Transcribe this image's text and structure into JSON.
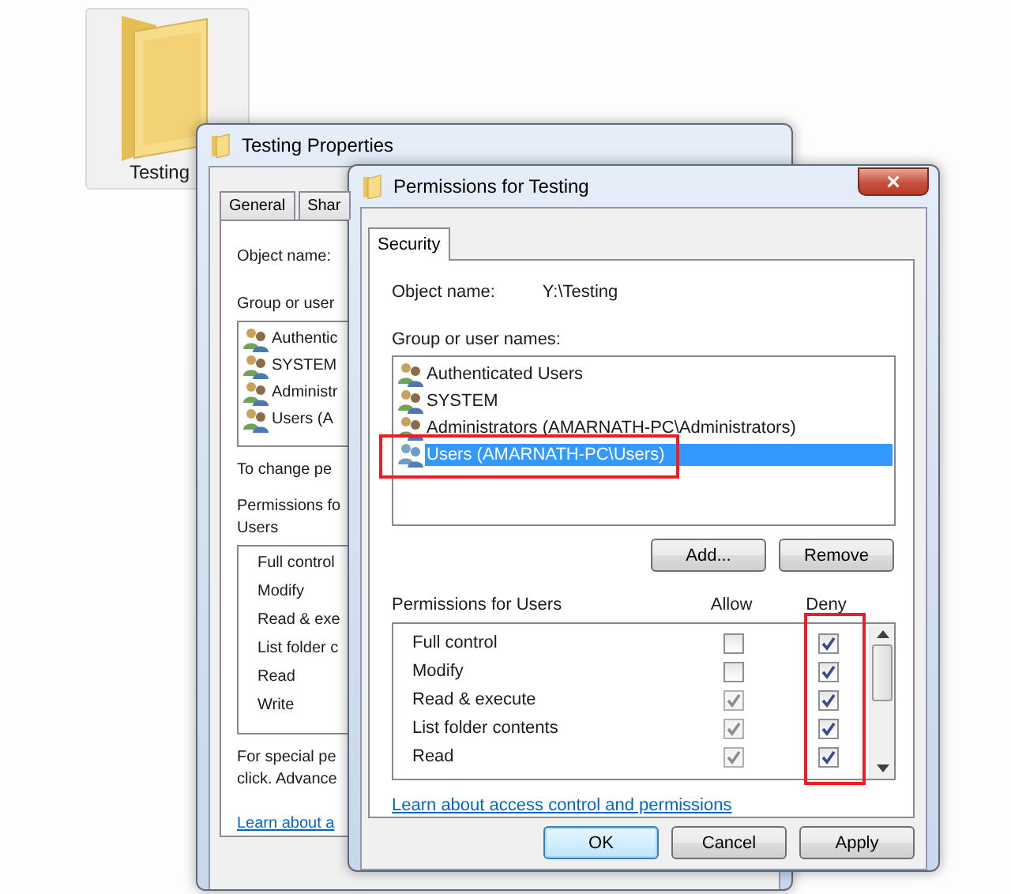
{
  "desktop_icon": {
    "label": "Testing",
    "selected": true
  },
  "properties_window": {
    "title": "Testing Properties",
    "tabs": [
      {
        "label": "General",
        "selected": false
      },
      {
        "label": "Shar",
        "selected": false
      }
    ],
    "object_name_label": "Object name:",
    "group_label": "Group or user",
    "users": [
      "Authentic",
      "SYSTEM",
      "Administr",
      "Users (A"
    ],
    "change_text": "To change pe",
    "permissions_label": "Permissions fo",
    "permissions_user": "Users",
    "permissions": [
      "Full control",
      "Modify",
      "Read & exe",
      "List folder c",
      "Read",
      "Write"
    ],
    "special_text": [
      "For special pe",
      "click. Advance"
    ],
    "link": "Learn about a"
  },
  "permissions_window": {
    "title": "Permissions for Testing",
    "close": "×",
    "tabs": [
      {
        "label": "Security",
        "selected": true
      }
    ],
    "object_name_label": "Object name:",
    "object_name": "Y:\\Testing",
    "group_label": "Group or user names:",
    "users": [
      {
        "name": "Authenticated Users",
        "selected": false
      },
      {
        "name": "SYSTEM",
        "selected": false
      },
      {
        "name": "Administrators (AMARNATH-PC\\Administrators)",
        "selected": false
      },
      {
        "name": "Users (AMARNATH-PC\\Users)",
        "selected": true
      }
    ],
    "user_buttons": [
      {
        "label": "Add..."
      },
      {
        "label": "Remove"
      }
    ],
    "permissions_label": "Permissions for Users",
    "allow_label": "Allow",
    "deny_label": "Deny",
    "permissions": [
      {
        "name": "Full control",
        "allow": {
          "checked": false,
          "disabled": false
        },
        "deny": {
          "checked": true,
          "disabled": false
        }
      },
      {
        "name": "Modify",
        "allow": {
          "checked": false,
          "disabled": false
        },
        "deny": {
          "checked": true,
          "disabled": false
        }
      },
      {
        "name": "Read & execute",
        "allow": {
          "checked": true,
          "disabled": true
        },
        "deny": {
          "checked": true,
          "disabled": false
        }
      },
      {
        "name": "List folder contents",
        "allow": {
          "checked": true,
          "disabled": true
        },
        "deny": {
          "checked": true,
          "disabled": false
        }
      },
      {
        "name": "Read",
        "allow": {
          "checked": true,
          "disabled": true
        },
        "deny": {
          "checked": true,
          "disabled": false
        }
      }
    ],
    "link": "Learn about access control and permissions",
    "buttons": [
      {
        "label": "OK",
        "default": true
      },
      {
        "label": "Cancel",
        "default": false
      },
      {
        "label": "Apply",
        "default": false
      }
    ]
  }
}
